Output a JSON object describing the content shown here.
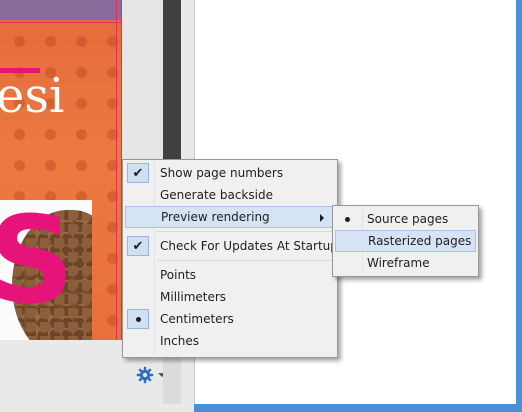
{
  "menu": {
    "items": [
      {
        "label": "Show page numbers",
        "checked": true,
        "mark": "check"
      },
      {
        "label": "Generate backside",
        "checked": false
      },
      {
        "label": "Preview rendering",
        "checked": false,
        "submenu": true,
        "highlighted": true
      },
      {
        "label": "Check For Updates At Startup",
        "checked": true,
        "mark": "check"
      },
      {
        "label": "Points",
        "checked": false
      },
      {
        "label": "Millimeters",
        "checked": false
      },
      {
        "label": "Centimeters",
        "checked": true,
        "mark": "dot"
      },
      {
        "label": "Inches",
        "checked": false
      }
    ]
  },
  "submenu": {
    "items": [
      {
        "label": "Source pages",
        "checked": true,
        "mark": "dot"
      },
      {
        "label": "Rasterized pages",
        "checked": false,
        "highlighted": true
      },
      {
        "label": "Wireframe",
        "checked": false
      }
    ]
  },
  "preview": {
    "visible_text": "esi"
  },
  "icons": {
    "settings": "gear-icon",
    "dropdown": "chevron-down-icon",
    "check": "checkmark-icon",
    "radio": "radio-dot-icon",
    "submenu_arrow": "submenu-arrow-icon"
  },
  "colors": {
    "accent": "#1e6fcf",
    "menu_highlight": "#d5e3f5",
    "check_background": "#cfe0f4",
    "page_orange": "#ec7a40",
    "magenta": "#e3166f"
  }
}
